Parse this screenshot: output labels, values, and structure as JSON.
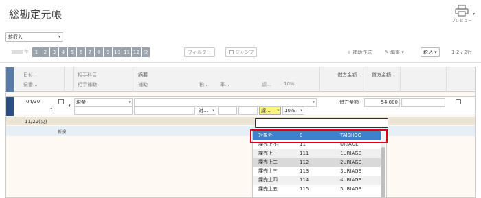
{
  "title": "総勘定元帳",
  "preview": {
    "label": "プレビュー",
    "caret": "▾",
    "icon": "printer-icon"
  },
  "account": {
    "value": "雑収入",
    "caret": "▾"
  },
  "toolbar": {
    "year_suffix": "年",
    "months": [
      "1",
      "2",
      "3",
      "4",
      "5",
      "6",
      "7",
      "8",
      "9",
      "10",
      "11",
      "12",
      "決"
    ],
    "filter": "フィルター",
    "jump": "ジャンプ",
    "add_aux": "+ 補助作成",
    "edit": "編集",
    "tax_mode": "税込",
    "pager": "1-2 / 2行"
  },
  "header": {
    "date": "日付...",
    "voucher": "伝番...",
    "counter_account": "相手科目",
    "counter_sub": "相手補助",
    "memo": "摘要",
    "sub": "補助",
    "tax": "税...",
    "rate": "率...",
    "tax_class": "課...",
    "tax_rate": "10%",
    "debit": "借方金額...",
    "credit": "貸方金額..."
  },
  "entry": {
    "date": "04/30",
    "voucher": "1",
    "account": "現金",
    "debit_label": "借方金額",
    "amount": "54,000",
    "tax_field": "対...",
    "tax_class": "課...",
    "rate": "10%"
  },
  "day_row": {
    "date": "11/22(火)",
    "new_label": "新規"
  },
  "dropdown": {
    "options": [
      {
        "name": "対象外",
        "code": "0",
        "key": "TAISHOG",
        "style": "sel"
      },
      {
        "name": "課売上不",
        "code": "11",
        "key": "URIAGE",
        "style": ""
      },
      {
        "name": "課売上一",
        "code": "111",
        "key": "1URIAGE",
        "style": "alt"
      },
      {
        "name": "課売上二",
        "code": "112",
        "key": "2URIAGE",
        "style": "dark"
      },
      {
        "name": "課売上三",
        "code": "113",
        "key": "3URIAGE",
        "style": ""
      },
      {
        "name": "課売上四",
        "code": "114",
        "key": "4URIAGE",
        "style": "alt"
      },
      {
        "name": "課売上五",
        "code": "115",
        "key": "5URIAGE",
        "style": ""
      }
    ]
  },
  "colors": {
    "accent": "#3d82d1",
    "highlight": "#e0001b",
    "header_blue": "#5a7ca8",
    "month_bg": "#9aa3ab"
  }
}
